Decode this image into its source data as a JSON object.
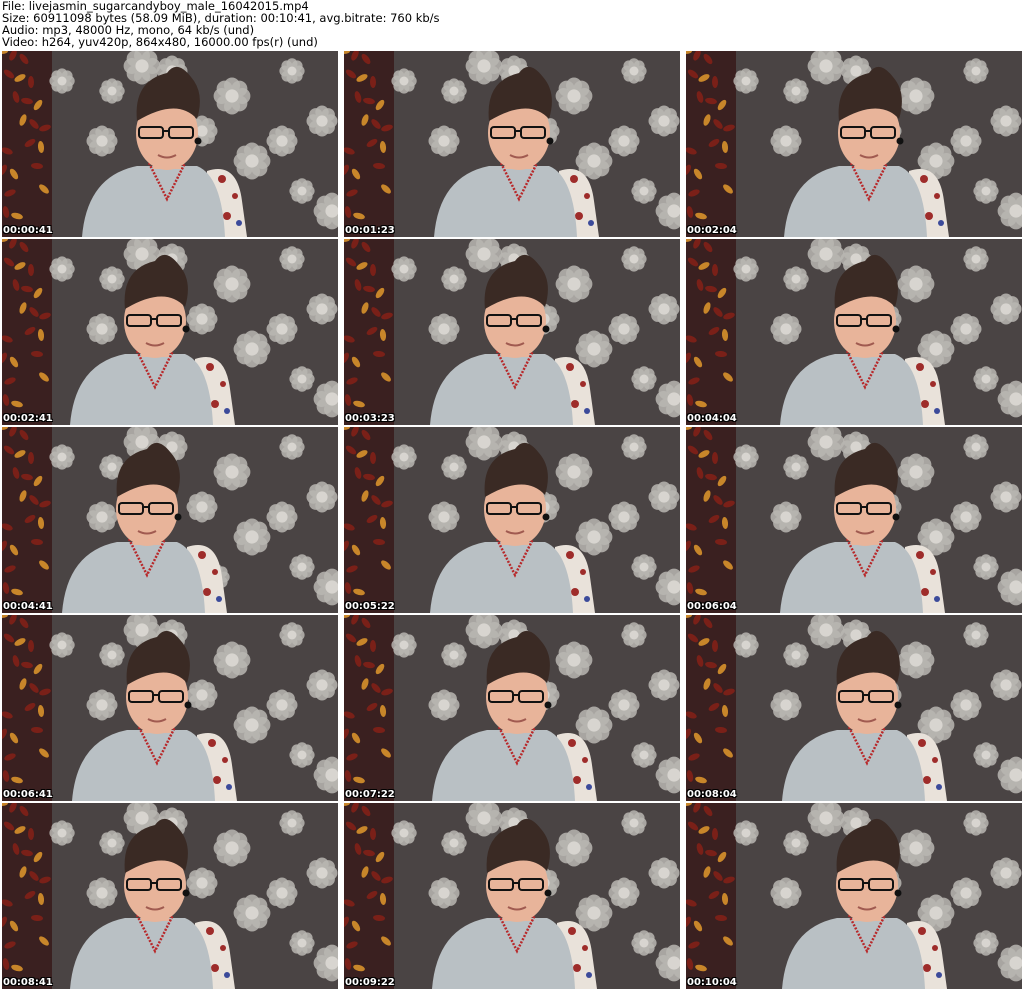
{
  "header": {
    "file_line": "File: livejasmin_sugarcandyboy_male_16042015.mp4",
    "size_line": "Size: 60911098 bytes (58.09 MiB), duration: 00:10:41, avg.bitrate: 760 kb/s",
    "audio_line": "Audio: mp3, 48000 Hz, mono, 64 kb/s (und)",
    "video_line": "Video: h264, yuv420p, 864x480, 16000.00 fps(r) (und)"
  },
  "frames": [
    {
      "timestamp": "00:00:41"
    },
    {
      "timestamp": "00:01:23"
    },
    {
      "timestamp": "00:02:04"
    },
    {
      "timestamp": "00:02:41"
    },
    {
      "timestamp": "00:03:23"
    },
    {
      "timestamp": "00:04:04"
    },
    {
      "timestamp": "00:04:41"
    },
    {
      "timestamp": "00:05:22"
    },
    {
      "timestamp": "00:06:04"
    },
    {
      "timestamp": "00:06:41"
    },
    {
      "timestamp": "00:07:22"
    },
    {
      "timestamp": "00:08:04"
    },
    {
      "timestamp": "00:08:41"
    },
    {
      "timestamp": "00:09:22"
    },
    {
      "timestamp": "00:10:04"
    }
  ],
  "colors": {
    "background": "#ffffff",
    "curtain": "#4a4444",
    "flower": "#b9b6b2",
    "skin": "#e8b49a",
    "hair": "#3a2a24",
    "shirt": "#b9c0c4",
    "necklace": "#b8282a",
    "chair_red": "#9e2c2a",
    "timestamp_text": "#ffffff"
  }
}
